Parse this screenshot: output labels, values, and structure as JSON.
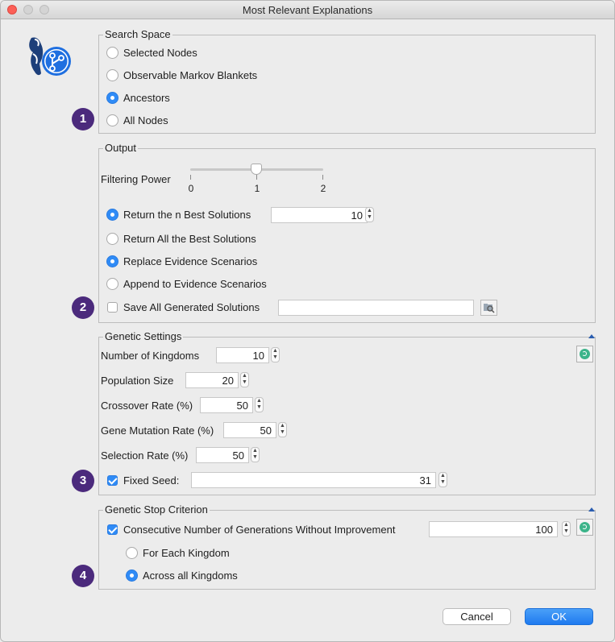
{
  "window": {
    "title": "Most Relevant Explanations"
  },
  "search_space": {
    "legend": "Search Space",
    "options": [
      {
        "label": "Selected Nodes",
        "selected": false
      },
      {
        "label": "Observable Markov Blankets",
        "selected": false
      },
      {
        "label": "Ancestors",
        "selected": true
      },
      {
        "label": "All Nodes",
        "selected": false
      }
    ]
  },
  "output": {
    "legend": "Output",
    "filtering_power": {
      "label": "Filtering Power",
      "ticks": [
        "0",
        "1",
        "2"
      ],
      "value": 1,
      "min": 0,
      "max": 2
    },
    "return_n_best": {
      "label": "Return the n Best Solutions",
      "selected": true,
      "value": "10"
    },
    "return_all_best": {
      "label": "Return All the Best Solutions",
      "selected": false
    },
    "replace_scenarios": {
      "label": "Replace Evidence Scenarios",
      "selected": true
    },
    "append_scenarios": {
      "label": "Append to Evidence Scenarios",
      "selected": false
    },
    "save_all": {
      "label": "Save All Generated Solutions",
      "checked": false,
      "value": ""
    }
  },
  "genetic_settings": {
    "legend": "Genetic Settings",
    "kingdoms": {
      "label": "Number of Kingdoms",
      "value": "10"
    },
    "population": {
      "label": "Population Size",
      "value": "20"
    },
    "crossover": {
      "label": "Crossover Rate (%)",
      "value": "50"
    },
    "mutation": {
      "label": "Gene Mutation Rate (%)",
      "value": "50"
    },
    "selection": {
      "label": "Selection Rate (%)",
      "value": "50"
    },
    "fixed_seed": {
      "label": "Fixed Seed:",
      "checked": true,
      "value": "31"
    }
  },
  "stop_criterion": {
    "legend": "Genetic Stop Criterion",
    "consecutive": {
      "label": "Consecutive Number of Generations Without Improvement",
      "checked": true,
      "value": "100"
    },
    "for_each": {
      "label": "For Each Kingdom",
      "selected": false
    },
    "across_all": {
      "label": "Across all Kingdoms",
      "selected": true
    }
  },
  "badges": [
    "1",
    "2",
    "3",
    "4"
  ],
  "buttons": {
    "cancel": "Cancel",
    "ok": "OK"
  },
  "colors": {
    "accent": "#2f8bf6",
    "badge": "#4b2a7c",
    "refresh": "#3cb48a"
  }
}
